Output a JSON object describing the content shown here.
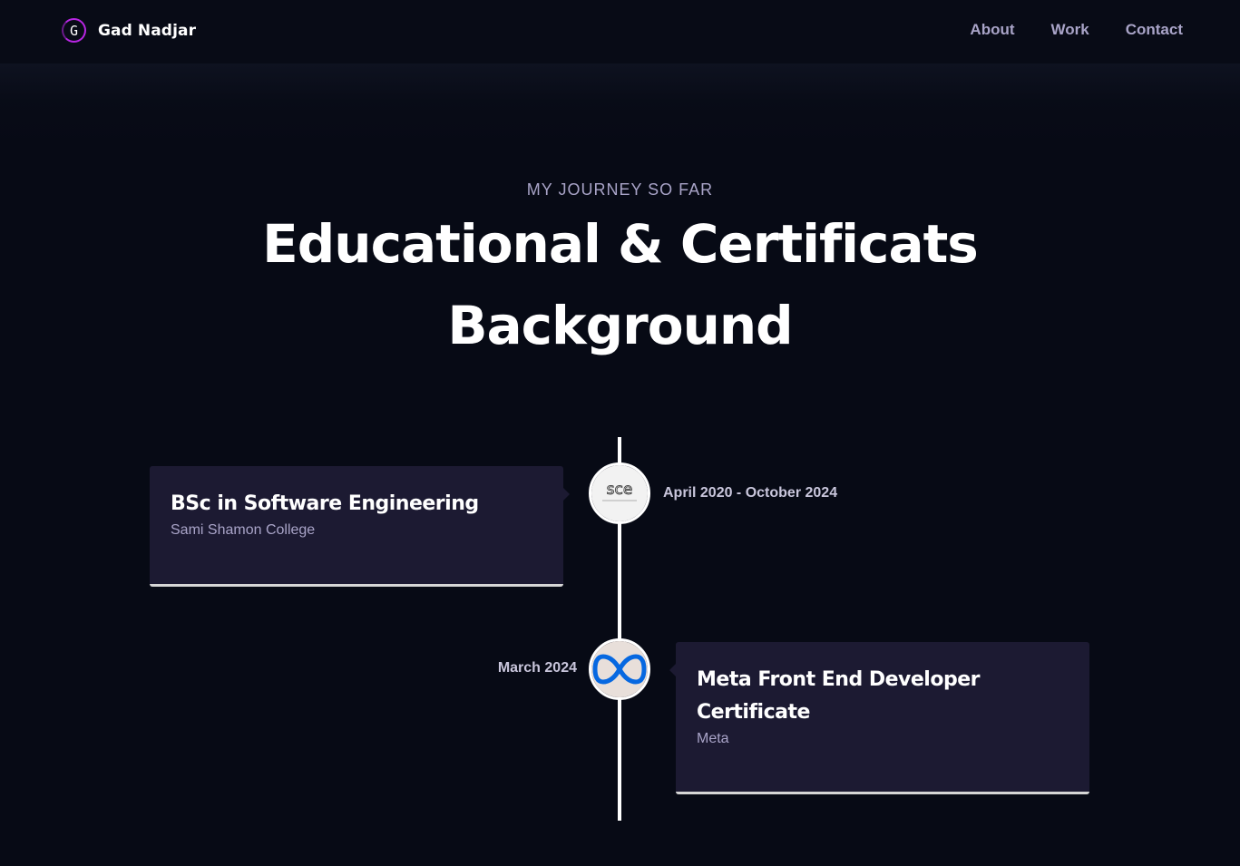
{
  "brand": {
    "logo_letter": "G",
    "name": "Gad Nadjar"
  },
  "nav": {
    "items": [
      "About",
      "Work",
      "Contact"
    ]
  },
  "section": {
    "subtitle": "MY JOURNEY SO FAR",
    "title_line1": "Educational & Certificats",
    "title_line2": "Background"
  },
  "timeline": [
    {
      "title": "BSc in Software Engineering",
      "institution": "Sami Shamon College",
      "date": "April 2020 - October 2024",
      "icon": "sce-logo-icon",
      "logo_text": "sce"
    },
    {
      "title": "Meta Front End Developer Certificate",
      "institution": "Meta",
      "date": "March 2024",
      "icon": "meta-logo-icon"
    }
  ],
  "colors": {
    "background": "#070a15",
    "card": "#1c1a32",
    "muted_text": "#a9a4c8",
    "accent": "#b826e3",
    "meta_blue": "#0668e1"
  }
}
